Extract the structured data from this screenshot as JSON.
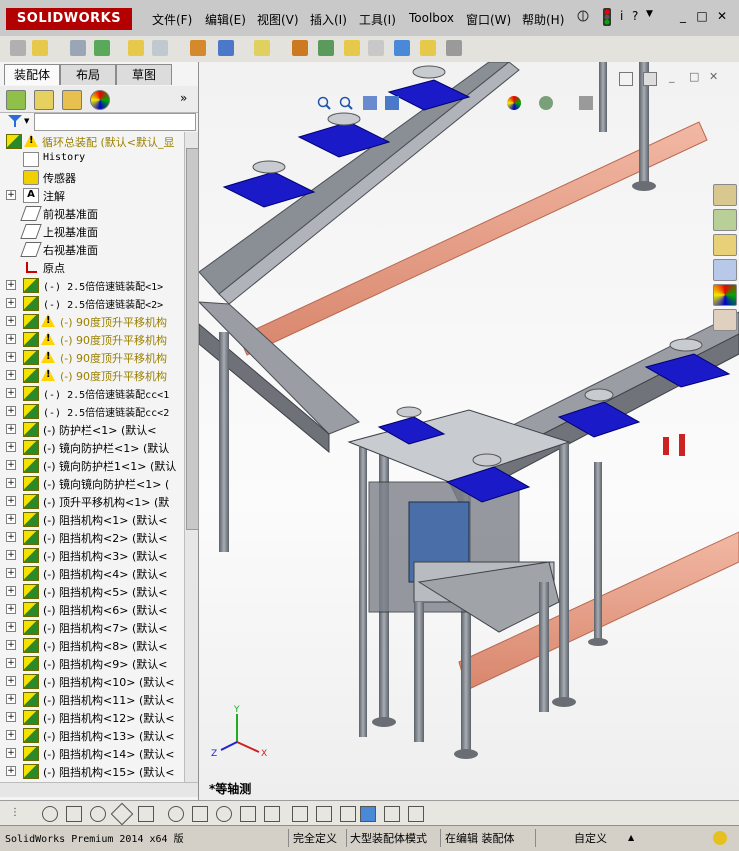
{
  "app": {
    "logo_text": "SOLIDWORKS",
    "menus": [
      "文件(F)",
      "编辑(E)",
      "视图(V)",
      "插入(I)",
      "工具(I)",
      "Toolbox",
      "窗口(W)",
      "帮助(H)"
    ],
    "window_controls": [
      "_",
      "□",
      "✕"
    ]
  },
  "panel": {
    "tabs": [
      "装配体",
      "布局",
      "草图"
    ],
    "root_label": "循环总装配  (默认<默认_显",
    "items": [
      {
        "label": "History",
        "icon": "history-icon",
        "expand": false,
        "warn": false,
        "mono": true
      },
      {
        "label": "传感器",
        "icon": "sensor-icon",
        "expand": false,
        "warn": false
      },
      {
        "label": "注解",
        "icon": "annotation-icon",
        "expand": true,
        "warn": false
      },
      {
        "label": "前视基准面",
        "icon": "plane-icon",
        "expand": false,
        "warn": false
      },
      {
        "label": "上视基准面",
        "icon": "plane-icon",
        "expand": false,
        "warn": false
      },
      {
        "label": "右视基准面",
        "icon": "plane-icon",
        "expand": false,
        "warn": false
      },
      {
        "label": "原点",
        "icon": "origin-icon",
        "expand": false,
        "warn": false
      },
      {
        "label": "(-) 2.5倍倍速链装配<1>",
        "icon": "assembly-icon",
        "expand": true,
        "warn": false,
        "mono": true
      },
      {
        "label": "(-) 2.5倍倍速链装配<2>",
        "icon": "assembly-icon",
        "expand": true,
        "warn": false,
        "mono": true
      },
      {
        "label": "(-) 90度顶升平移机构",
        "icon": "assembly-icon",
        "expand": true,
        "warn": true
      },
      {
        "label": "(-) 90度顶升平移机构",
        "icon": "assembly-icon",
        "expand": true,
        "warn": true
      },
      {
        "label": "(-) 90度顶升平移机构",
        "icon": "assembly-icon",
        "expand": true,
        "warn": true
      },
      {
        "label": "(-) 90度顶升平移机构",
        "icon": "assembly-icon",
        "expand": true,
        "warn": true
      },
      {
        "label": "(-) 2.5倍倍速链装配cc<1",
        "icon": "assembly-icon",
        "expand": true,
        "warn": false,
        "mono": true
      },
      {
        "label": "(-) 2.5倍倍速链装配cc<2",
        "icon": "assembly-icon",
        "expand": true,
        "warn": false,
        "mono": true
      },
      {
        "label": "(-) 防护栏<1>  (默认<",
        "icon": "assembly-icon",
        "expand": true,
        "warn": false
      },
      {
        "label": "(-) 镜向防护栏<1>  (默认",
        "icon": "assembly-icon",
        "expand": true,
        "warn": false
      },
      {
        "label": "(-) 镜向防护栏1<1>  (默认",
        "icon": "assembly-icon",
        "expand": true,
        "warn": false
      },
      {
        "label": "(-) 镜向镜向防护栏<1>  (",
        "icon": "assembly-icon",
        "expand": true,
        "warn": false
      },
      {
        "label": "(-) 顶升平移机构<1>  (默",
        "icon": "assembly-icon",
        "expand": true,
        "warn": false
      },
      {
        "label": "(-) 阻挡机构<1>  (默认<",
        "icon": "assembly-icon",
        "expand": true,
        "warn": false
      },
      {
        "label": "(-) 阻挡机构<2>  (默认<",
        "icon": "assembly-icon",
        "expand": true,
        "warn": false
      },
      {
        "label": "(-) 阻挡机构<3>  (默认<",
        "icon": "assembly-icon",
        "expand": true,
        "warn": false
      },
      {
        "label": "(-) 阻挡机构<4>  (默认<",
        "icon": "assembly-icon",
        "expand": true,
        "warn": false
      },
      {
        "label": "(-) 阻挡机构<5>  (默认<",
        "icon": "assembly-icon",
        "expand": true,
        "warn": false
      },
      {
        "label": "(-) 阻挡机构<6>  (默认<",
        "icon": "assembly-icon",
        "expand": true,
        "warn": false
      },
      {
        "label": "(-) 阻挡机构<7>  (默认<",
        "icon": "assembly-icon",
        "expand": true,
        "warn": false
      },
      {
        "label": "(-) 阻挡机构<8>  (默认<",
        "icon": "assembly-icon",
        "expand": true,
        "warn": false
      },
      {
        "label": "(-) 阻挡机构<9>  (默认<",
        "icon": "assembly-icon",
        "expand": true,
        "warn": false
      },
      {
        "label": "(-) 阻挡机构<10>  (默认<",
        "icon": "assembly-icon",
        "expand": true,
        "warn": false
      },
      {
        "label": "(-) 阻挡机构<11>  (默认<",
        "icon": "assembly-icon",
        "expand": true,
        "warn": false
      },
      {
        "label": "(-) 阻挡机构<12>  (默认<",
        "icon": "assembly-icon",
        "expand": true,
        "warn": false
      },
      {
        "label": "(-) 阻挡机构<13>  (默认<",
        "icon": "assembly-icon",
        "expand": true,
        "warn": false
      },
      {
        "label": "(-) 阻挡机构<14>  (默认<",
        "icon": "assembly-icon",
        "expand": true,
        "warn": false
      },
      {
        "label": "(-) 阻挡机构<15>  (默认<",
        "icon": "assembly-icon",
        "expand": true,
        "warn": false
      }
    ]
  },
  "viewport": {
    "view_label": "*等轴测",
    "triad_labels": [
      "Y",
      "X",
      "Z"
    ]
  },
  "status": {
    "product": "SolidWorks Premium 2014 x64 版",
    "define_state": "完全定义",
    "mode": "大型装配体模式",
    "editing": "在编辑 装配体",
    "custom": "自定义"
  },
  "colors": {
    "conveyor_blue": "#1a1ac8",
    "frame_gray": "#7a7f86",
    "rail_salmon": "#e8a08a",
    "warning_yellow": "#ffd400"
  }
}
